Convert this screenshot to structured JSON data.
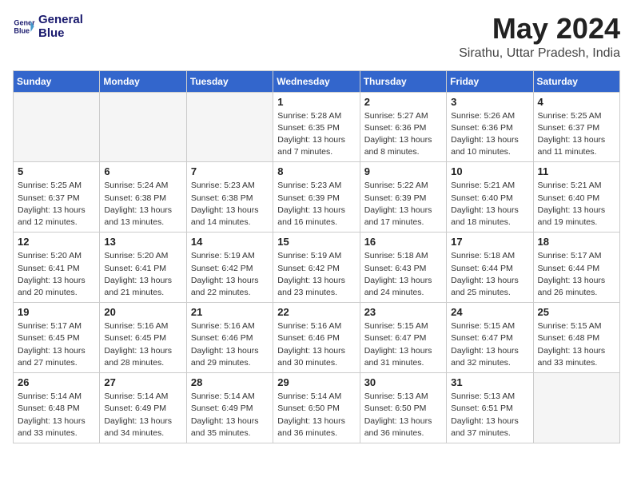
{
  "header": {
    "logo_line1": "General",
    "logo_line2": "Blue",
    "month": "May 2024",
    "location": "Sirathu, Uttar Pradesh, India"
  },
  "weekdays": [
    "Sunday",
    "Monday",
    "Tuesday",
    "Wednesday",
    "Thursday",
    "Friday",
    "Saturday"
  ],
  "weeks": [
    [
      {
        "day": "",
        "info": ""
      },
      {
        "day": "",
        "info": ""
      },
      {
        "day": "",
        "info": ""
      },
      {
        "day": "1",
        "info": "Sunrise: 5:28 AM\nSunset: 6:35 PM\nDaylight: 13 hours\nand 7 minutes."
      },
      {
        "day": "2",
        "info": "Sunrise: 5:27 AM\nSunset: 6:36 PM\nDaylight: 13 hours\nand 8 minutes."
      },
      {
        "day": "3",
        "info": "Sunrise: 5:26 AM\nSunset: 6:36 PM\nDaylight: 13 hours\nand 10 minutes."
      },
      {
        "day": "4",
        "info": "Sunrise: 5:25 AM\nSunset: 6:37 PM\nDaylight: 13 hours\nand 11 minutes."
      }
    ],
    [
      {
        "day": "5",
        "info": "Sunrise: 5:25 AM\nSunset: 6:37 PM\nDaylight: 13 hours\nand 12 minutes."
      },
      {
        "day": "6",
        "info": "Sunrise: 5:24 AM\nSunset: 6:38 PM\nDaylight: 13 hours\nand 13 minutes."
      },
      {
        "day": "7",
        "info": "Sunrise: 5:23 AM\nSunset: 6:38 PM\nDaylight: 13 hours\nand 14 minutes."
      },
      {
        "day": "8",
        "info": "Sunrise: 5:23 AM\nSunset: 6:39 PM\nDaylight: 13 hours\nand 16 minutes."
      },
      {
        "day": "9",
        "info": "Sunrise: 5:22 AM\nSunset: 6:39 PM\nDaylight: 13 hours\nand 17 minutes."
      },
      {
        "day": "10",
        "info": "Sunrise: 5:21 AM\nSunset: 6:40 PM\nDaylight: 13 hours\nand 18 minutes."
      },
      {
        "day": "11",
        "info": "Sunrise: 5:21 AM\nSunset: 6:40 PM\nDaylight: 13 hours\nand 19 minutes."
      }
    ],
    [
      {
        "day": "12",
        "info": "Sunrise: 5:20 AM\nSunset: 6:41 PM\nDaylight: 13 hours\nand 20 minutes."
      },
      {
        "day": "13",
        "info": "Sunrise: 5:20 AM\nSunset: 6:41 PM\nDaylight: 13 hours\nand 21 minutes."
      },
      {
        "day": "14",
        "info": "Sunrise: 5:19 AM\nSunset: 6:42 PM\nDaylight: 13 hours\nand 22 minutes."
      },
      {
        "day": "15",
        "info": "Sunrise: 5:19 AM\nSunset: 6:42 PM\nDaylight: 13 hours\nand 23 minutes."
      },
      {
        "day": "16",
        "info": "Sunrise: 5:18 AM\nSunset: 6:43 PM\nDaylight: 13 hours\nand 24 minutes."
      },
      {
        "day": "17",
        "info": "Sunrise: 5:18 AM\nSunset: 6:44 PM\nDaylight: 13 hours\nand 25 minutes."
      },
      {
        "day": "18",
        "info": "Sunrise: 5:17 AM\nSunset: 6:44 PM\nDaylight: 13 hours\nand 26 minutes."
      }
    ],
    [
      {
        "day": "19",
        "info": "Sunrise: 5:17 AM\nSunset: 6:45 PM\nDaylight: 13 hours\nand 27 minutes."
      },
      {
        "day": "20",
        "info": "Sunrise: 5:16 AM\nSunset: 6:45 PM\nDaylight: 13 hours\nand 28 minutes."
      },
      {
        "day": "21",
        "info": "Sunrise: 5:16 AM\nSunset: 6:46 PM\nDaylight: 13 hours\nand 29 minutes."
      },
      {
        "day": "22",
        "info": "Sunrise: 5:16 AM\nSunset: 6:46 PM\nDaylight: 13 hours\nand 30 minutes."
      },
      {
        "day": "23",
        "info": "Sunrise: 5:15 AM\nSunset: 6:47 PM\nDaylight: 13 hours\nand 31 minutes."
      },
      {
        "day": "24",
        "info": "Sunrise: 5:15 AM\nSunset: 6:47 PM\nDaylight: 13 hours\nand 32 minutes."
      },
      {
        "day": "25",
        "info": "Sunrise: 5:15 AM\nSunset: 6:48 PM\nDaylight: 13 hours\nand 33 minutes."
      }
    ],
    [
      {
        "day": "26",
        "info": "Sunrise: 5:14 AM\nSunset: 6:48 PM\nDaylight: 13 hours\nand 33 minutes."
      },
      {
        "day": "27",
        "info": "Sunrise: 5:14 AM\nSunset: 6:49 PM\nDaylight: 13 hours\nand 34 minutes."
      },
      {
        "day": "28",
        "info": "Sunrise: 5:14 AM\nSunset: 6:49 PM\nDaylight: 13 hours\nand 35 minutes."
      },
      {
        "day": "29",
        "info": "Sunrise: 5:14 AM\nSunset: 6:50 PM\nDaylight: 13 hours\nand 36 minutes."
      },
      {
        "day": "30",
        "info": "Sunrise: 5:13 AM\nSunset: 6:50 PM\nDaylight: 13 hours\nand 36 minutes."
      },
      {
        "day": "31",
        "info": "Sunrise: 5:13 AM\nSunset: 6:51 PM\nDaylight: 13 hours\nand 37 minutes."
      },
      {
        "day": "",
        "info": ""
      }
    ]
  ]
}
